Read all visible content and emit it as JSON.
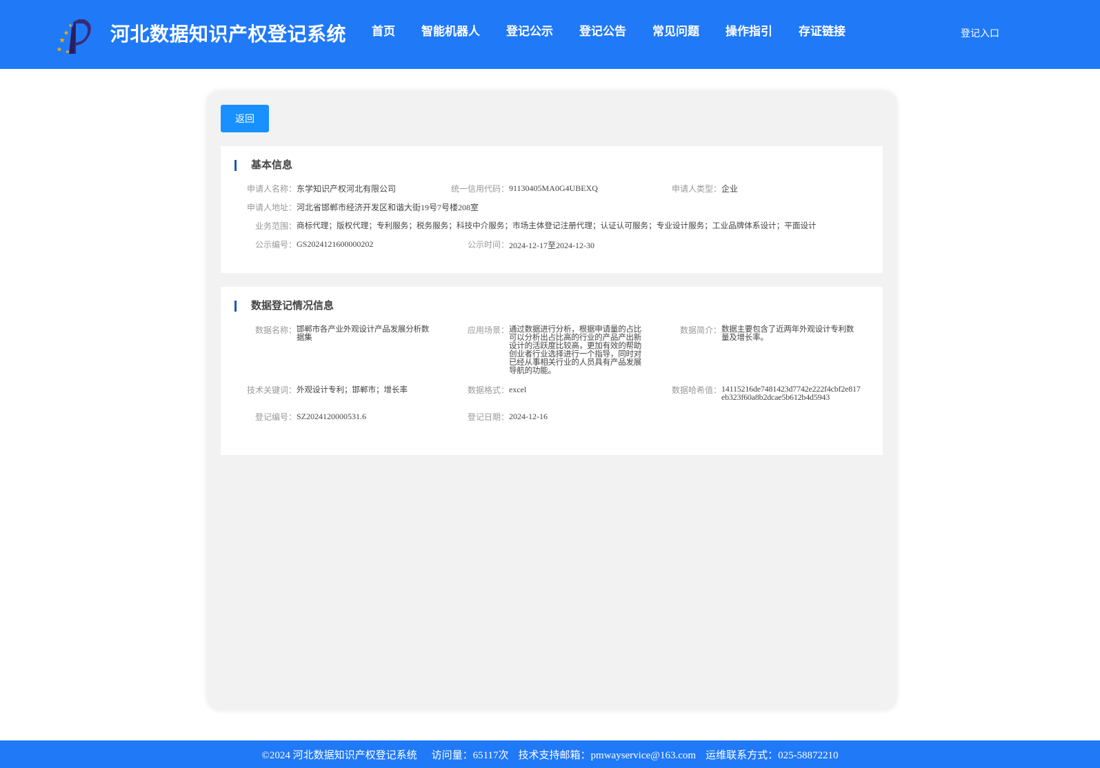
{
  "header": {
    "site_title": "河北数据知识产权登记系统",
    "nav": [
      "首页",
      "智能机器人",
      "登记公示",
      "登记公告",
      "常见问题",
      "操作指引",
      "存证链接"
    ],
    "login_label": "登记入口"
  },
  "main": {
    "back_label": "返回",
    "basic_info": {
      "title": "基本信息",
      "applicant_name_label": "申请人名称：",
      "applicant_name": "东学知识产权河北有限公司",
      "credit_code_label": "统一信用代码：",
      "credit_code": "91130405MA0G4UBEXQ",
      "applicant_type_label": "申请人类型：",
      "applicant_type": "企业",
      "address_label": "申请人地址：",
      "address": "河北省邯郸市经济开发区和谐大街19号7号楼208室",
      "scope_label": "业务范围：",
      "scope": "商标代理；版权代理；专利服务；税务服务；科技中介服务；市场主体登记注册代理；认证认可服务；专业设计服务；工业品牌体系设计；平面设计",
      "notice_no_label": "公示编号：",
      "notice_no": "GS2024121600000202",
      "notice_time_label": "公示时间：",
      "notice_time": "2024-12-17至2024-12-30"
    },
    "data_info": {
      "title": "数据登记情况信息",
      "data_name_label": "数据名称：",
      "data_name": "邯郸市各产业外观设计产品发展分析数据集",
      "scenario_label": "应用场景：",
      "scenario": "通过数据进行分析，根据申请量的占比可以分析出占比高的行业的产品产出新设计的活跃度比较高，更加有效的帮助创业者行业选择进行一个指导，同时对已经从事相关行业的人员具有产品发展导航的功能。",
      "intro_label": "数据简介：",
      "intro": "数据主要包含了近两年外观设计专利数量及增长率。",
      "keywords_label": "技术关键词：",
      "keywords": "外观设计专利；邯郸市；增长率",
      "format_label": "数据格式：",
      "format": "excel",
      "hash_label": "数据哈希值：",
      "hash": "14115216de7481423d7742e222f4cbf2e817eb323f60a8b2dcae5b612b4d5943",
      "reg_no_label": "登记编号：",
      "reg_no": "SZ2024120000531.6",
      "reg_date_label": "登记日期：",
      "reg_date": "2024-12-16"
    }
  },
  "footer": {
    "copyright": "©2024 河北数据知识产权登记系统",
    "visits": "访问量：65117次",
    "support_email": "技术支持邮箱：pmwayservice@163.com",
    "ops_contact": "运维联系方式：025-58872210"
  },
  "colors": {
    "header_bg": "#2079f7",
    "button_bg": "#1890ff",
    "title_bar": "#1a56b3",
    "container_bg": "#f2f2f2"
  }
}
